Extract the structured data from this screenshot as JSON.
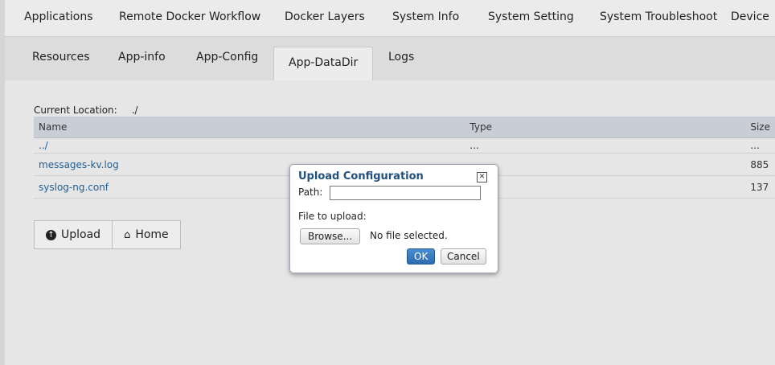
{
  "top_nav": {
    "items": [
      "Applications",
      "Remote Docker Workflow",
      "Docker Layers",
      "System Info",
      "System Setting",
      "System Troubleshoot",
      "Device"
    ]
  },
  "sub_nav": {
    "tabs": [
      "Resources",
      "App-info",
      "App-Config",
      "App-DataDir",
      "Logs"
    ],
    "active": "App-DataDir"
  },
  "location": {
    "label": "Current Location:",
    "value": "./"
  },
  "file_table": {
    "headers": [
      "Name",
      "Type",
      "Size"
    ],
    "rows": [
      {
        "name": "../",
        "type": "...",
        "size": "..."
      },
      {
        "name": "messages-kv.log",
        "type": "",
        "size": "885"
      },
      {
        "name": "syslog-ng.conf",
        "type": "",
        "size": "137"
      }
    ]
  },
  "actions": {
    "upload_label": "Upload",
    "home_label": "Home"
  },
  "dialog": {
    "title": "Upload Configuration",
    "path_label": "Path:",
    "path_value": "",
    "file_label": "File to upload:",
    "browse_label": "Browse...",
    "no_file_text": "No file selected.",
    "ok_label": "OK",
    "cancel_label": "Cancel"
  }
}
